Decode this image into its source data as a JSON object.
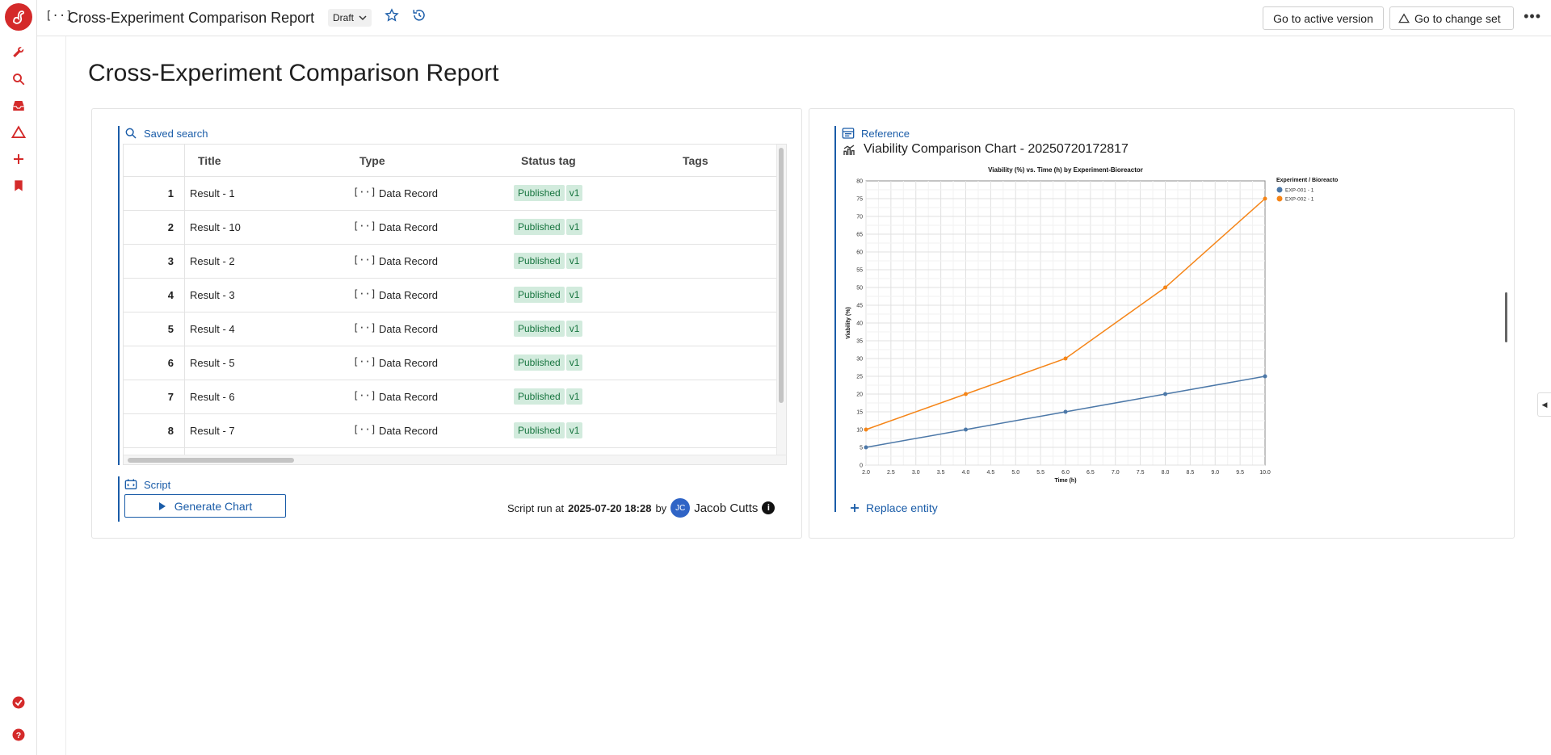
{
  "topbar": {
    "title": "Cross-Experiment Comparison Report",
    "status": "Draft",
    "active_version_label": "Go to active version",
    "change_set_label": "Go to change set"
  },
  "page": {
    "title": "Cross-Experiment Comparison Report"
  },
  "saved_search": {
    "label": "Saved search",
    "columns": [
      "Title",
      "Type",
      "Status tag",
      "Tags"
    ],
    "rows": [
      {
        "num": "1",
        "title": "Result - 1",
        "type": "Data Record",
        "status": "Published",
        "version": "v1"
      },
      {
        "num": "2",
        "title": "Result - 10",
        "type": "Data Record",
        "status": "Published",
        "version": "v1"
      },
      {
        "num": "3",
        "title": "Result - 2",
        "type": "Data Record",
        "status": "Published",
        "version": "v1"
      },
      {
        "num": "4",
        "title": "Result - 3",
        "type": "Data Record",
        "status": "Published",
        "version": "v1"
      },
      {
        "num": "5",
        "title": "Result - 4",
        "type": "Data Record",
        "status": "Published",
        "version": "v1"
      },
      {
        "num": "6",
        "title": "Result - 5",
        "type": "Data Record",
        "status": "Published",
        "version": "v1"
      },
      {
        "num": "7",
        "title": "Result - 6",
        "type": "Data Record",
        "status": "Published",
        "version": "v1"
      },
      {
        "num": "8",
        "title": "Result - 7",
        "type": "Data Record",
        "status": "Published",
        "version": "v1"
      }
    ]
  },
  "script": {
    "label": "Script",
    "button_label": "Generate Chart",
    "run_prefix": "Script run at",
    "run_time": "2025-07-20 18:28",
    "run_by": "by",
    "user_initials": "JC",
    "user_name": "Jacob Cutts"
  },
  "reference": {
    "label": "Reference",
    "title": "Viability Comparison Chart - 20250720172817",
    "replace_label": "Replace entity"
  },
  "chart_data": {
    "type": "line",
    "title": "Viability (%) vs. Time (h) by Experiment-Bioreactor",
    "xlabel": "Time (h)",
    "ylabel": "Viability (%)",
    "xlim": [
      2.0,
      10.0
    ],
    "ylim": [
      0,
      80
    ],
    "x_ticks": [
      "2.0",
      "2.5",
      "3.0",
      "3.5",
      "4.0",
      "4.5",
      "5.0",
      "5.5",
      "6.0",
      "6.5",
      "7.0",
      "7.5",
      "8.0",
      "8.5",
      "9.0",
      "9.5",
      "10.0"
    ],
    "y_ticks": [
      "0",
      "5",
      "10",
      "15",
      "20",
      "25",
      "30",
      "35",
      "40",
      "45",
      "50",
      "55",
      "60",
      "65",
      "70",
      "75",
      "80"
    ],
    "legend_title": "Experiment / Bioreactor",
    "legend_position": "right",
    "grid": true,
    "series": [
      {
        "name": "EXP-001 - 1",
        "color": "#4c78a8",
        "x": [
          2,
          4,
          6,
          8,
          10
        ],
        "y": [
          5,
          10,
          15,
          20,
          25
        ]
      },
      {
        "name": "EXP-002 - 1",
        "color": "#f58518",
        "x": [
          2,
          4,
          6,
          8,
          10
        ],
        "y": [
          10,
          20,
          30,
          50,
          75
        ]
      }
    ]
  }
}
